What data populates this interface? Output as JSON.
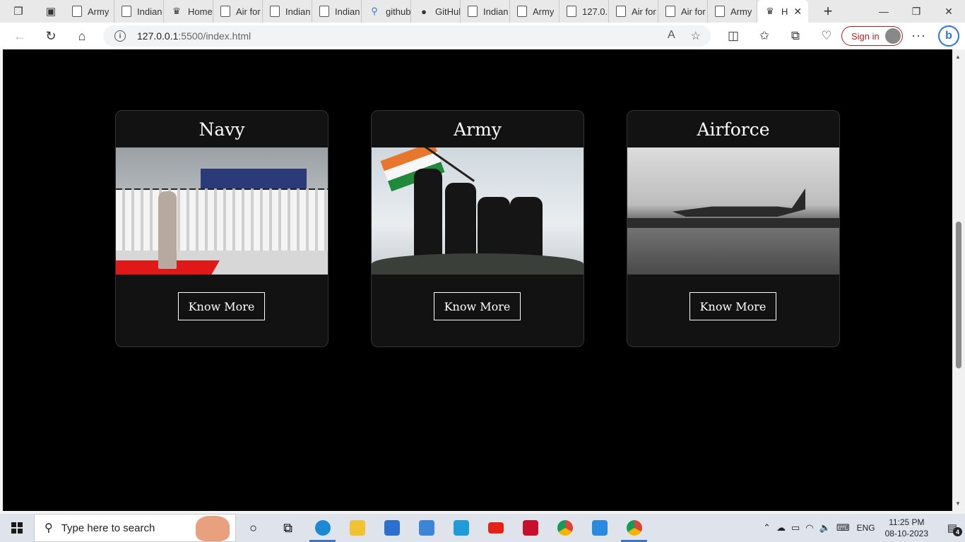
{
  "browser": {
    "tabs": [
      {
        "label": "Army",
        "icon": "page-icon"
      },
      {
        "label": "Indian",
        "icon": "page-icon"
      },
      {
        "label": "Home",
        "icon": "emblem-icon"
      },
      {
        "label": "Air for",
        "icon": "page-icon"
      },
      {
        "label": "Indian",
        "icon": "page-icon"
      },
      {
        "label": "Indian",
        "icon": "page-icon"
      },
      {
        "label": "github",
        "icon": "search-icon"
      },
      {
        "label": "GitHub",
        "icon": "github-icon"
      },
      {
        "label": "Indian",
        "icon": "page-icon"
      },
      {
        "label": "Army",
        "icon": "page-icon"
      },
      {
        "label": "127.0.",
        "icon": "page-icon"
      },
      {
        "label": "Air for",
        "icon": "page-icon"
      },
      {
        "label": "Air for",
        "icon": "page-icon"
      },
      {
        "label": "Army",
        "icon": "page-icon"
      }
    ],
    "active_tab": {
      "label": "H",
      "icon": "emblem-icon"
    },
    "url_host": "127.0.0.1",
    "url_rest": ":5500/index.html",
    "signin_label": "Sign in"
  },
  "page": {
    "cards": [
      {
        "title": "Navy",
        "button": "Know More"
      },
      {
        "title": "Army",
        "button": "Know More"
      },
      {
        "title": "Airforce",
        "button": "Know More"
      }
    ]
  },
  "taskbar": {
    "search_placeholder": "Type here to search",
    "language": "ENG",
    "time": "11:25 PM",
    "date": "08-10-2023",
    "notification_count": "4"
  }
}
